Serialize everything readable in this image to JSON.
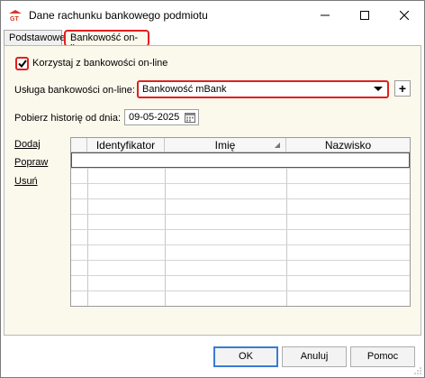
{
  "window": {
    "title": "Dane rachunku bankowego podmiotu"
  },
  "tabs": [
    {
      "label": "Podstawowe"
    },
    {
      "label": "Bankowość on-line"
    }
  ],
  "online": {
    "use_online_label": "Korzystaj z bankowości on-line",
    "use_online_checked": true,
    "service_label": "Usługa bankowości on-line:",
    "service_value": "Bankowość mBank",
    "add_service_label": "+",
    "history_label": "Pobierz historię od dnia:",
    "history_date": "09-05-2025"
  },
  "actions": {
    "add": "Dodaj",
    "edit": "Popraw",
    "delete": "Usuń"
  },
  "grid": {
    "columns": [
      "",
      "Identyfikator",
      "Imię",
      "Nazwisko"
    ],
    "rows": []
  },
  "buttons": {
    "ok": "OK",
    "cancel": "Anuluj",
    "help": "Pomoc"
  },
  "colors": {
    "highlight": "#e02020",
    "panel": "#fbf8ec",
    "default_button": "#3a7bd5"
  }
}
